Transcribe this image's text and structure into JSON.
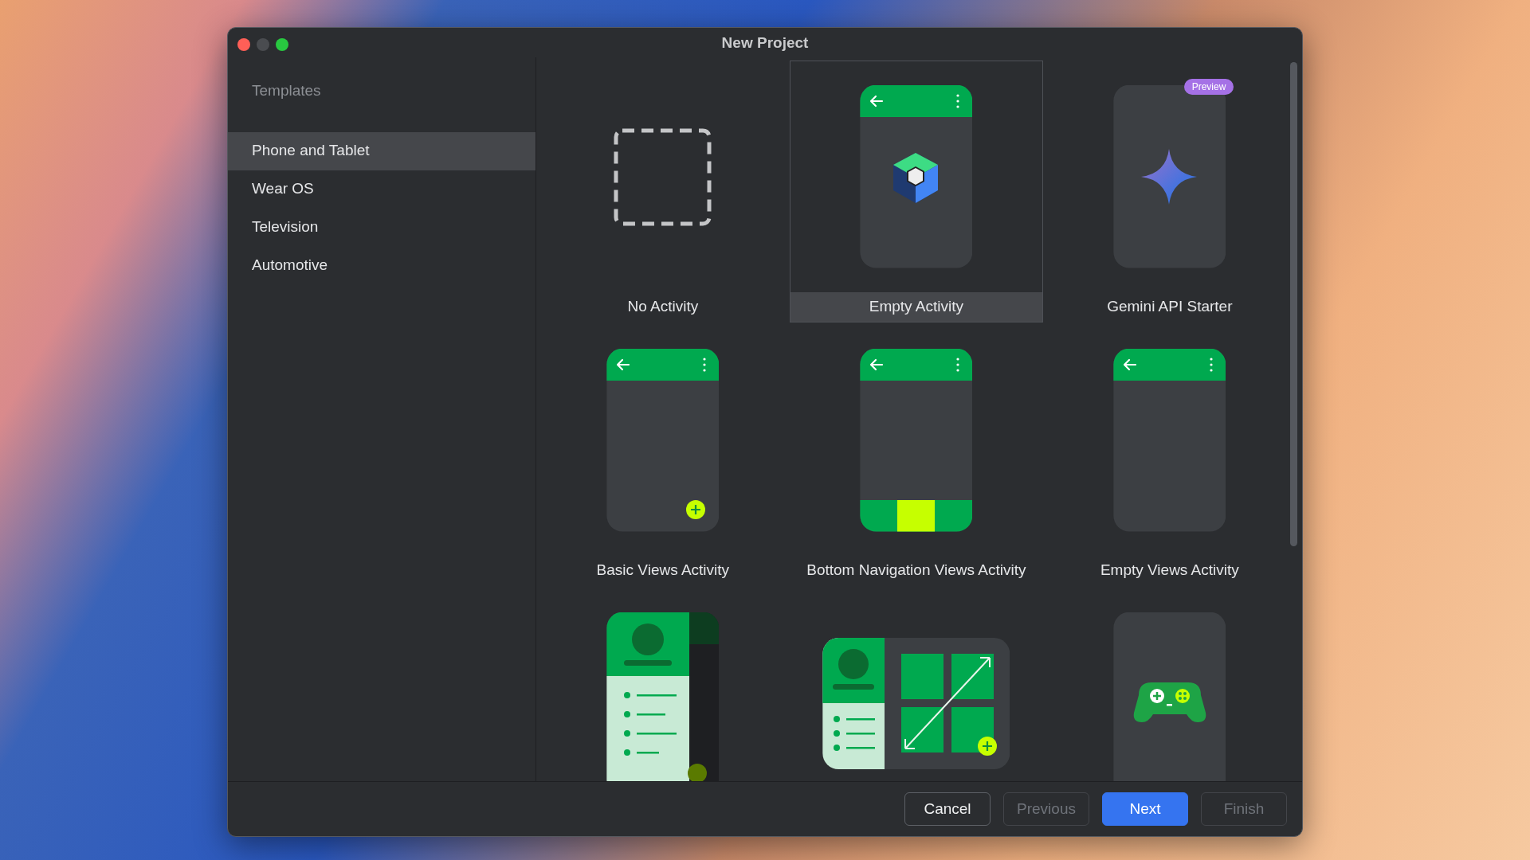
{
  "window": {
    "title": "New Project"
  },
  "sidebar": {
    "heading": "Templates",
    "items": [
      {
        "label": "Phone and Tablet",
        "selected": true
      },
      {
        "label": "Wear OS",
        "selected": false
      },
      {
        "label": "Television",
        "selected": false
      },
      {
        "label": "Automotive",
        "selected": false
      }
    ]
  },
  "templates": [
    {
      "kind": "none",
      "label": "No Activity",
      "selected": false
    },
    {
      "kind": "compose",
      "label": "Empty Activity",
      "selected": true
    },
    {
      "kind": "gemini",
      "label": "Gemini API Starter",
      "badge": "Preview",
      "selected": false
    },
    {
      "kind": "basic",
      "label": "Basic Views Activity",
      "selected": false
    },
    {
      "kind": "bottom-nav",
      "label": "Bottom Navigation Views Activity",
      "selected": false
    },
    {
      "kind": "empty-views",
      "label": "Empty Views Activity",
      "selected": false
    },
    {
      "kind": "list-detail",
      "selected": false
    },
    {
      "kind": "tablet",
      "selected": false
    },
    {
      "kind": "game",
      "selected": false
    }
  ],
  "buttons": [
    {
      "label": "Cancel",
      "kind": "default",
      "disabled": false
    },
    {
      "label": "Previous",
      "kind": "default",
      "disabled": true
    },
    {
      "label": "Next",
      "kind": "primary",
      "disabled": false
    },
    {
      "label": "Finish",
      "kind": "default",
      "disabled": true
    }
  ]
}
